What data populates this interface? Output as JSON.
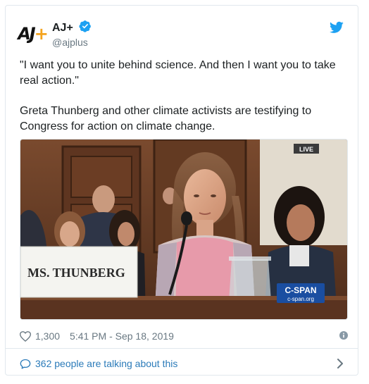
{
  "account": {
    "display_name": "AJ+",
    "handle": "@ajplus",
    "avatar_text": "AJ",
    "avatar_plus": "+"
  },
  "tweet": {
    "paragraph_1": "\"I want you to unite behind science. And then I want you to take real action.\"",
    "paragraph_2": "Greta Thunberg and other climate activists are testifying to Congress for action on climate change."
  },
  "media": {
    "live_badge": "LIVE",
    "nameplate": "MS. THUNBERG",
    "cspan_logo": "C-SPAN",
    "cspan_url": "c-span.org"
  },
  "meta": {
    "likes": "1,300",
    "timestamp": "5:41 PM - Sep 18, 2019"
  },
  "footer": {
    "talking": "362 people are talking about this"
  },
  "colors": {
    "verified": "#1da1f2",
    "twitter_blue": "#1da1f2",
    "link": "#2b7bb9",
    "muted": "#697882",
    "accent_plus": "#f4a31e"
  }
}
